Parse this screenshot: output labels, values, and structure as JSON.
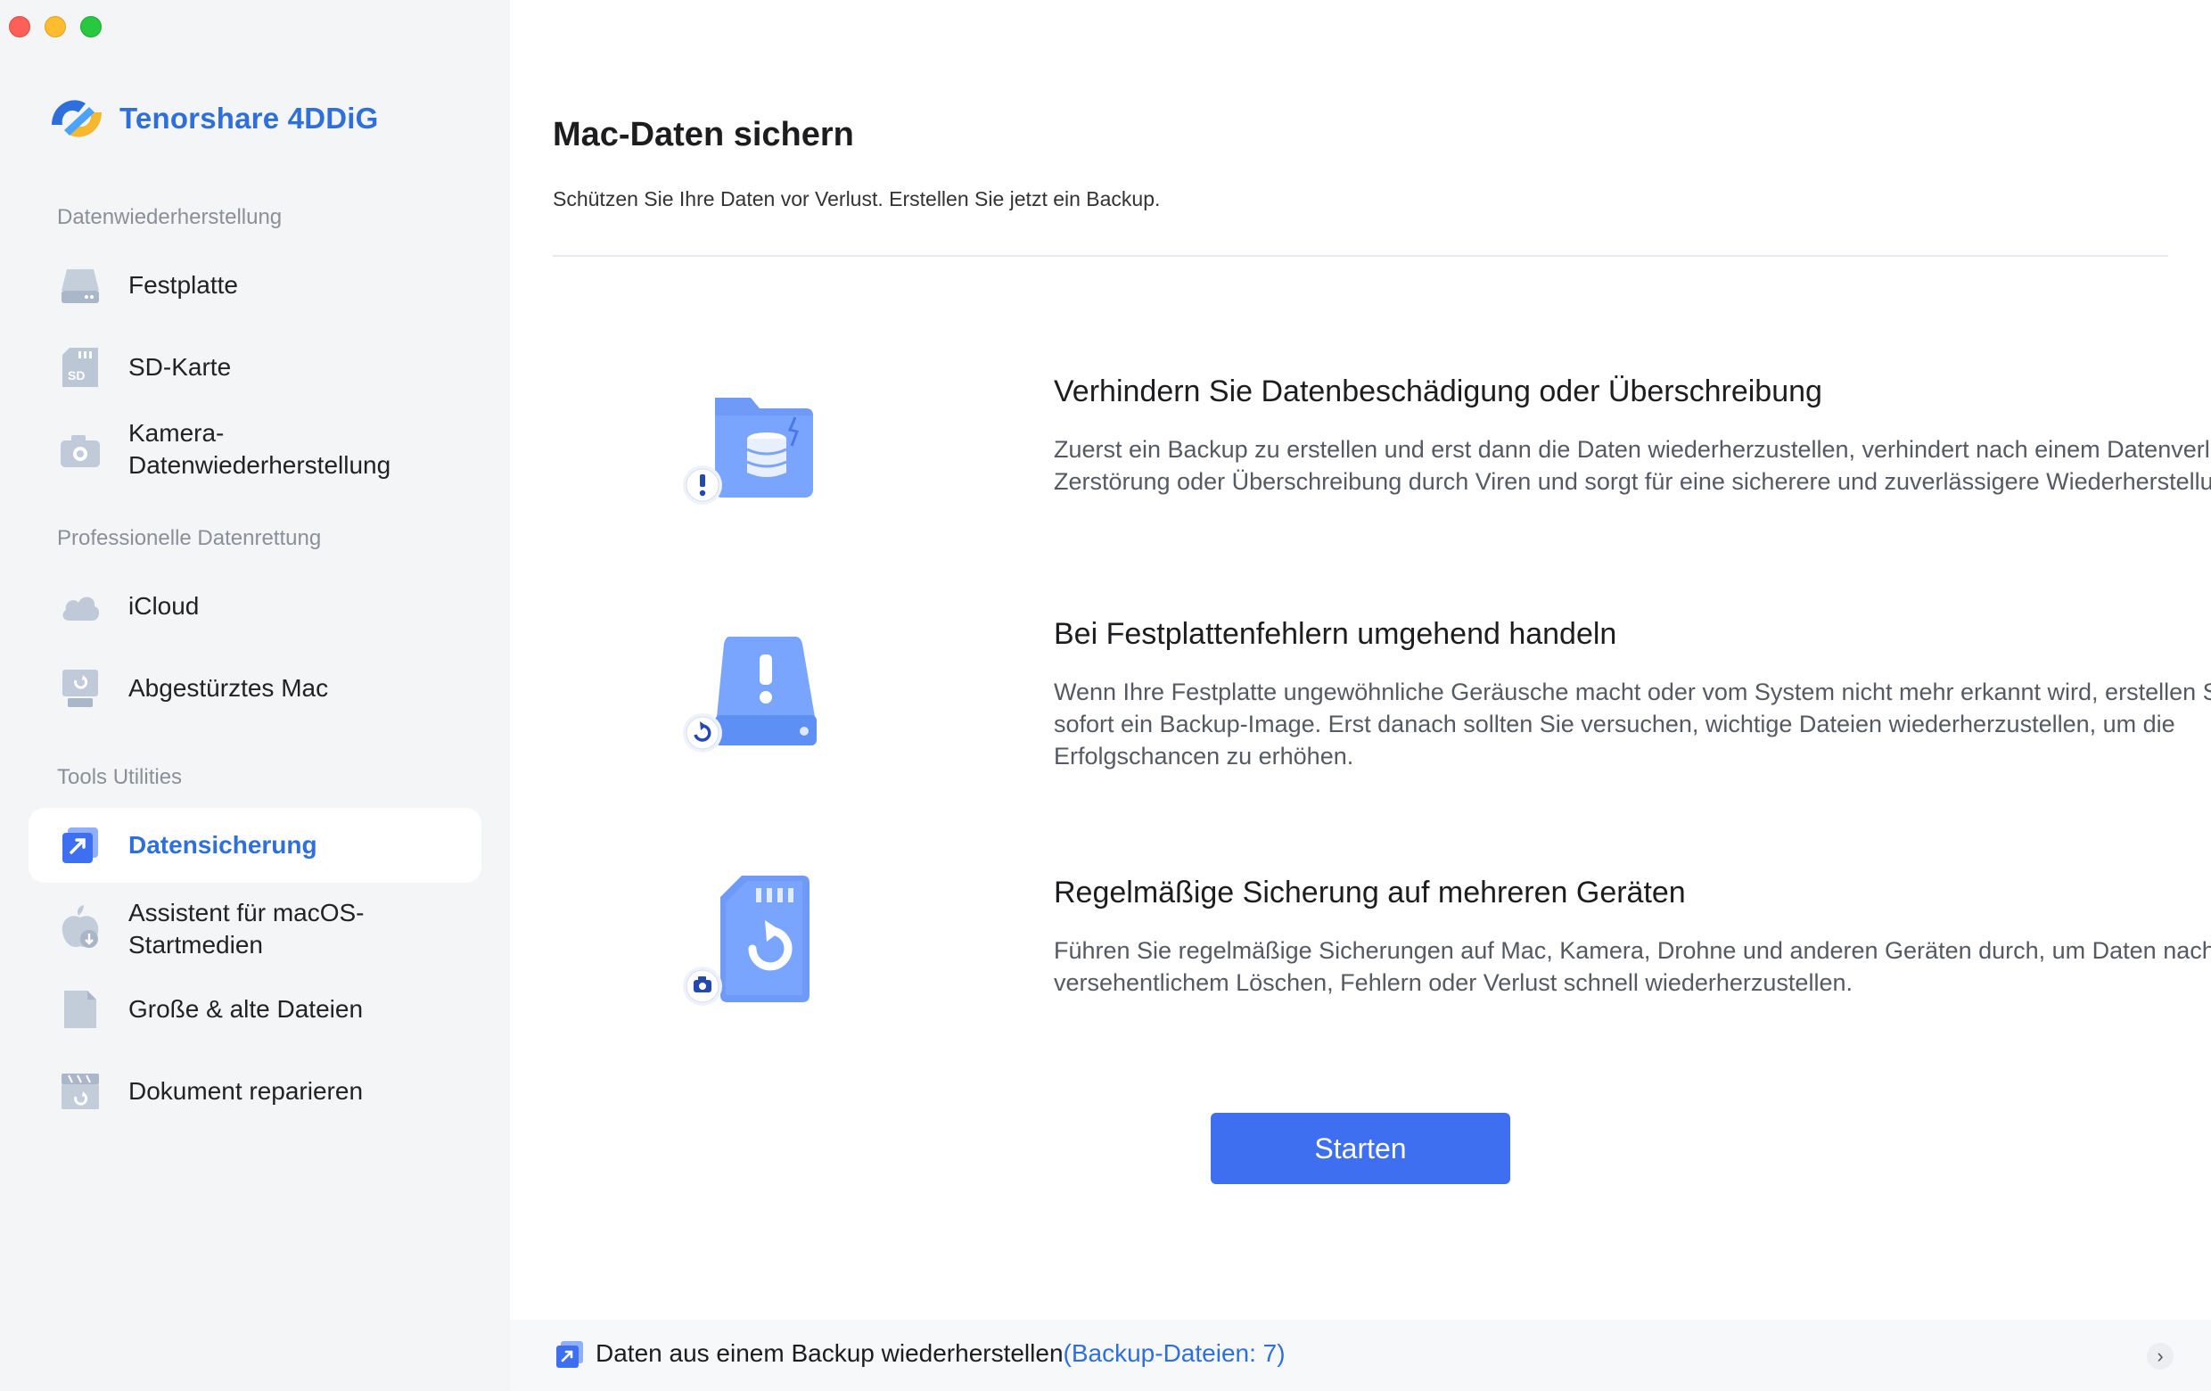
{
  "app": {
    "brand_name": "Tenorshare 4DDiG",
    "accent_color": "#2f6fdc",
    "button_color": "#3e6ff0"
  },
  "sidebar": {
    "sections": [
      {
        "title": "Datenwiederherstellung"
      },
      {
        "title": "Professionelle Datenrettung"
      },
      {
        "title": "Tools  Utilities"
      }
    ],
    "items": [
      {
        "label": "Festplatte",
        "icon": "hard-drive-icon"
      },
      {
        "label": "SD-Karte",
        "icon": "sd-card-icon"
      },
      {
        "label": "Kamera-\nDatenwiederherstellung",
        "icon": "camera-icon"
      },
      {
        "label": "iCloud",
        "icon": "cloud-icon"
      },
      {
        "label": "Abgestürztes Mac",
        "icon": "crashed-mac-icon"
      },
      {
        "label": "Datensicherung",
        "icon": "backup-icon",
        "active": true
      },
      {
        "label": "Assistent für macOS-\nStartmedien",
        "icon": "macos-installer-icon"
      },
      {
        "label": "Große & alte Dateien",
        "icon": "file-icon"
      },
      {
        "label": "Dokument reparieren",
        "icon": "document-repair-icon"
      }
    ]
  },
  "main": {
    "title": "Mac-Daten sichern",
    "subtitle": "Schützen Sie Ihre Daten vor Verlust. Erstellen Sie jetzt ein Backup.",
    "features": [
      {
        "title": "Verhindern Sie Datenbeschädigung oder Überschreibung",
        "text": "Zuerst ein Backup zu erstellen und erst dann die Daten wiederherzustellen, verhindert nach einem Datenverlust die Zerstörung oder Überschreibung durch Viren und sorgt für eine sicherere und zuverlässigere Wiederherstellung.",
        "icon": "folder-database-warning-icon"
      },
      {
        "title": "Bei Festplattenfehlern umgehend handeln",
        "text": "Wenn Ihre Festplatte ungewöhnliche Geräusche macht oder vom System nicht mehr erkannt wird, erstellen Sie sofort ein Backup-Image. Erst danach sollten Sie versuchen, wichtige Dateien wiederherzustellen, um die Erfolgschancen zu erhöhen.",
        "icon": "hard-drive-warning-icon"
      },
      {
        "title": "Regelmäßige Sicherung auf mehreren Geräten",
        "text": "Führen Sie regelmäßige Sicherungen auf Mac, Kamera, Drohne und anderen Geräten durch, um Daten nach versehentlichem Löschen, Fehlern oder Verlust schnell wiederherzustellen.",
        "icon": "sd-card-camera-icon"
      }
    ],
    "start_label": "Starten"
  },
  "footer": {
    "text": "Daten aus einem Backup wiederherstellen",
    "count_text": "(Backup-Dateien: 7)"
  }
}
